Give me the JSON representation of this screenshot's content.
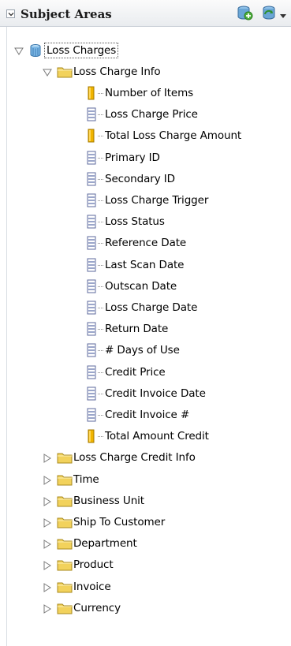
{
  "header": {
    "title": "Subject Areas"
  },
  "tree": {
    "root": {
      "label": "Loss Charges"
    },
    "folder_open": {
      "label": "Loss Charge Info"
    },
    "columns": [
      {
        "label": "Number of Items",
        "kind": "measure"
      },
      {
        "label": "Loss Charge Price",
        "kind": "attribute"
      },
      {
        "label": "Total Loss Charge Amount",
        "kind": "measure"
      },
      {
        "label": "Primary ID",
        "kind": "attribute"
      },
      {
        "label": "Secondary ID",
        "kind": "attribute"
      },
      {
        "label": "Loss Charge Trigger",
        "kind": "attribute"
      },
      {
        "label": "Loss Status",
        "kind": "attribute"
      },
      {
        "label": "Reference Date",
        "kind": "attribute"
      },
      {
        "label": "Last Scan Date",
        "kind": "attribute"
      },
      {
        "label": "Outscan Date",
        "kind": "attribute"
      },
      {
        "label": "Loss Charge Date",
        "kind": "attribute"
      },
      {
        "label": "Return Date",
        "kind": "attribute"
      },
      {
        "label": "# Days of Use",
        "kind": "attribute"
      },
      {
        "label": "Credit Price",
        "kind": "attribute"
      },
      {
        "label": "Credit Invoice Date",
        "kind": "attribute"
      },
      {
        "label": "Credit Invoice #",
        "kind": "attribute"
      },
      {
        "label": "Total Amount Credit",
        "kind": "measure"
      }
    ],
    "folders_closed": [
      {
        "label": "Loss Charge Credit Info"
      },
      {
        "label": "Time"
      },
      {
        "label": "Business Unit"
      },
      {
        "label": "Ship To Customer"
      },
      {
        "label": "Department"
      },
      {
        "label": "Product"
      },
      {
        "label": "Invoice"
      },
      {
        "label": "Currency"
      }
    ]
  },
  "colors": {
    "folder": "#f2d25c",
    "measure": "#f0b400",
    "attribute": "#7a88b8"
  }
}
